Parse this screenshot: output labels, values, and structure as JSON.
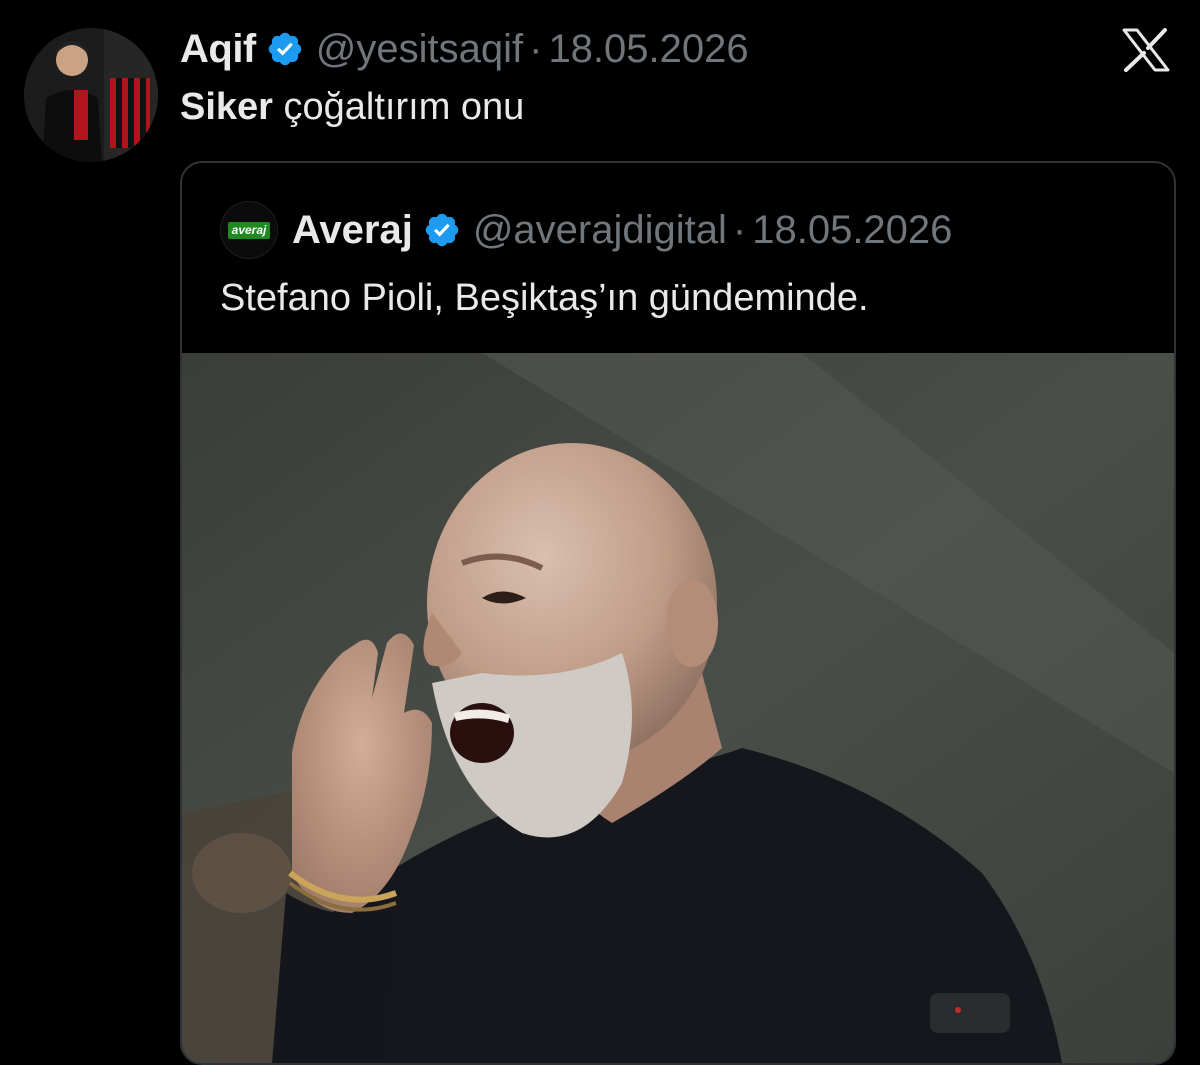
{
  "tweet": {
    "display_name": "Aqif",
    "handle": "@yesitsaqif",
    "separator": "·",
    "date": "18.05.2026",
    "text_bold": "Siker",
    "text_rest": " çoğaltırım onu",
    "verified_icon": "verified-badge-icon"
  },
  "platform": {
    "logo_icon": "x-logo-icon"
  },
  "quoted_tweet": {
    "avatar_logo_text": "averaj",
    "display_name": "Averaj",
    "handle": "@averajdigital",
    "separator": "·",
    "date": "18.05.2026",
    "text": "Stefano Pioli, Beşiktaş’ın gündeminde.",
    "verified_icon": "verified-badge-icon"
  },
  "colors": {
    "background": "#000000",
    "primary_text": "#e7e9ea",
    "secondary_text": "#71767b",
    "verified_blue": "#1d9bf0",
    "border": "#2f3336",
    "logo_green": "#1f8a1f"
  }
}
